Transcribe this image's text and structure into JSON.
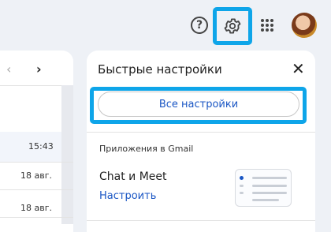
{
  "topbar": {
    "help_symbol": "?",
    "gear_icon": "gear-icon",
    "apps_icon": "apps-icon",
    "avatar_icon": "avatar"
  },
  "mail_list": {
    "prev_symbol": "‹",
    "next_symbol": "›",
    "times": [
      "15:43",
      "18 авг.",
      "18 авг."
    ]
  },
  "quick_settings": {
    "title": "Быстрые настройки",
    "close_symbol": "✕",
    "all_settings_label": "Все настройки",
    "apps_heading": "Приложения в Gmail",
    "chat_meet_label": "Chat и Meet",
    "configure_label": "Настроить"
  },
  "colors": {
    "highlight": "#0ea5e9",
    "link": "#1a56c4",
    "background": "#eef1f6"
  }
}
